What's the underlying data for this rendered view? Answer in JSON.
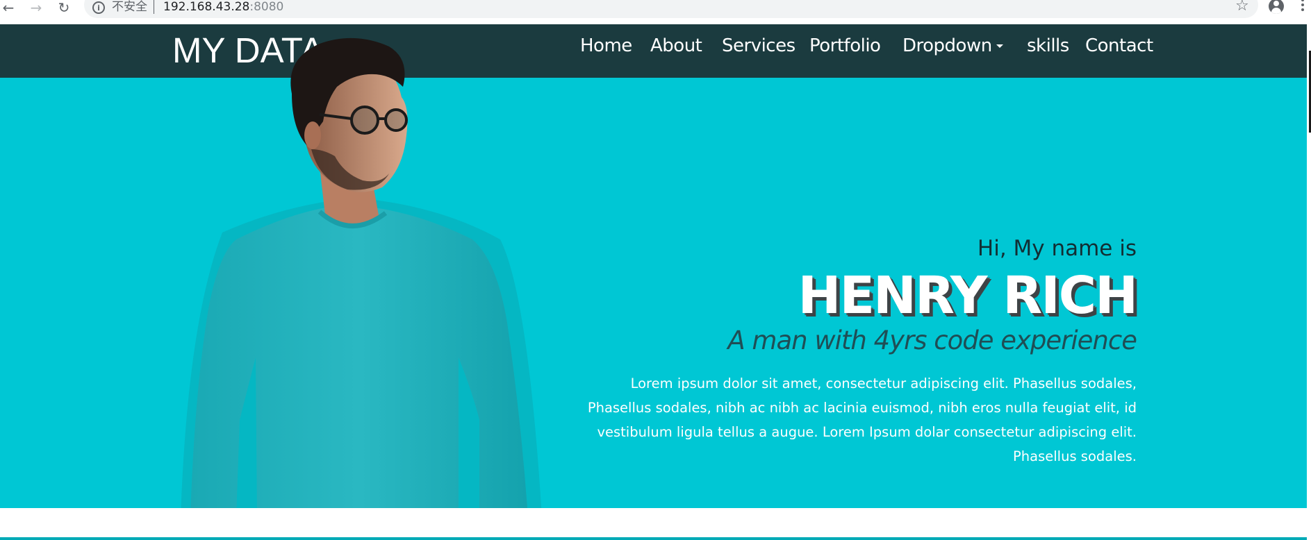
{
  "browser": {
    "security_label": "不安全",
    "url_host": "192.168.43.28",
    "url_port": ":8080"
  },
  "navbar": {
    "brand": "MY DATA",
    "links": [
      "Home",
      "About",
      "Services",
      "Portfolio",
      "Dropdown",
      "skills",
      "Contact"
    ]
  },
  "hero": {
    "greeting": "Hi, My name is",
    "name": "HENRY RICH",
    "tagline": "A man with 4yrs code experience",
    "description": [
      "Lorem ipsum dolor sit amet, consectetur adipiscing elit. Phasellus sodales,",
      "Phasellus sodales, nibh ac nibh ac lacinia euismod, nibh eros nulla feugiat elit, id",
      "vestibulum ligula tellus a augue. Lorem Ipsum dolar consectetur adipiscing elit.",
      "Phasellus sodales."
    ]
  },
  "colors": {
    "hero_bg": "#00c7d4",
    "navbar_bg": "#1c383c",
    "shirt": "#26b5bf"
  },
  "icons": [
    "arrow-back-icon",
    "arrow-forward-icon",
    "reload-icon",
    "info-icon",
    "star-icon",
    "account-icon",
    "menu-icon",
    "dropdown-caret-icon"
  ]
}
